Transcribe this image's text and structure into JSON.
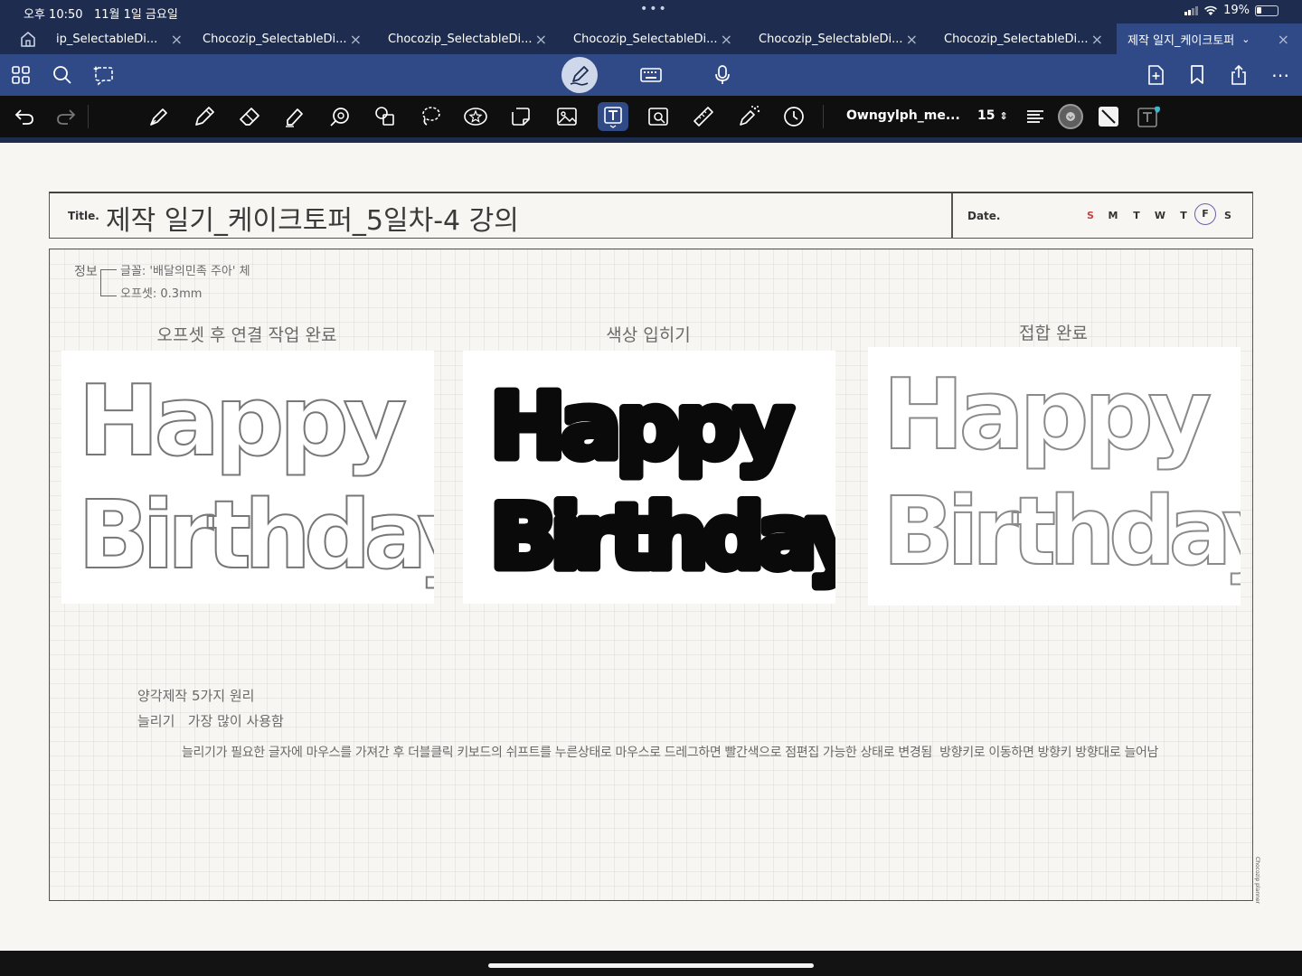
{
  "status_bar": {
    "time": "오후 10:50",
    "date": "11월 1일 금요일",
    "battery": "19%"
  },
  "tabs": [
    {
      "label": "ip_SelectableDi..."
    },
    {
      "label": "Chocozip_SelectableDi..."
    },
    {
      "label": "Chocozip_SelectableDi..."
    },
    {
      "label": "Chocozip_SelectableDi..."
    },
    {
      "label": "Chocozip_SelectableDi..."
    },
    {
      "label": "Chocozip_SelectableDi..."
    },
    {
      "label": "제작 일지_케이크토퍼",
      "active": true
    }
  ],
  "toolbar": {
    "font_name": "Owngylph_me...",
    "font_size": "15"
  },
  "page": {
    "title_label": "Title.",
    "title": "제작 일기_케이크토퍼_5일차-4 강의",
    "date_label": "Date.",
    "weekdays": [
      "S",
      "M",
      "T",
      "W",
      "T",
      "F",
      "S"
    ],
    "info_label": "정보",
    "info_font": "글꼴: '배달의민족 주아' 체",
    "info_offset": "오프셋: 0.3mm",
    "images": [
      {
        "caption": "오프셋 후 연결 작업 완료",
        "line1": "Happy",
        "line2": "Birthday",
        "style": "outline"
      },
      {
        "caption": "색상 입히기",
        "line1": "Happy",
        "line2": "Birthday",
        "style": "filled"
      },
      {
        "caption": "접합 완료",
        "line1": "Happy",
        "line2": "Birthday",
        "style": "outline"
      }
    ],
    "note_heading": "양각제작 5가지 원리",
    "note_sub": "늘리기   가장 많이 사용함",
    "note_body": "늘리기가 필요한 글자에 마우스를 가져간 후 더블클릭 키보드의 쉬프트를 누른상태로 마우스로 드레그하면 빨간색으로 점편집 가능한 상태로 변경됨  방향키로 이동하면 방향키 방향대로 늘어남",
    "side_mark": "Chocozip planner"
  },
  "colors": {
    "tab_bar": "#1e2d4f",
    "nav_bar": "#2f4a86",
    "toolbar": "#0f0f10",
    "paper": "#f8f6f3",
    "sunday": "#c9413f"
  }
}
